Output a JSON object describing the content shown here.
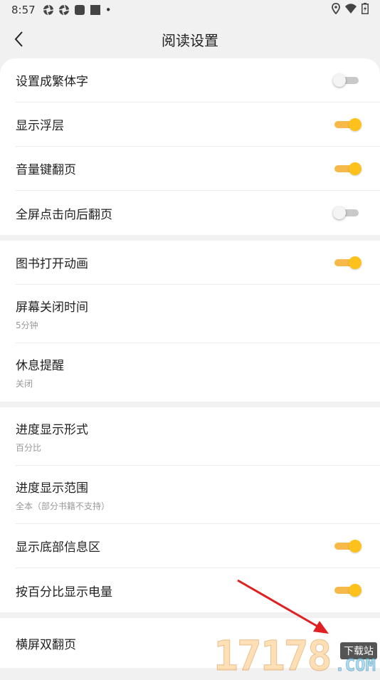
{
  "status": {
    "time": "8:57",
    "dot": "•"
  },
  "header": {
    "title": "阅读设置"
  },
  "section1": [
    {
      "label": "设置成繁体字",
      "toggle": "off"
    },
    {
      "label": "显示浮层",
      "toggle": "on"
    },
    {
      "label": "音量键翻页",
      "toggle": "on"
    },
    {
      "label": "全屏点击向后翻页",
      "toggle": "off"
    }
  ],
  "section2": [
    {
      "label": "图书打开动画",
      "toggle": "on"
    },
    {
      "label": "屏幕关闭时间",
      "sub": "5分钟"
    },
    {
      "label": "休息提醒",
      "sub": "关闭"
    }
  ],
  "section3": [
    {
      "label": "进度显示形式",
      "sub": "百分比"
    },
    {
      "label": "进度显示范围",
      "sub": "全本（部分书籍不支持）"
    },
    {
      "label": "显示底部信息区",
      "toggle": "on"
    },
    {
      "label": "按百分比显示电量",
      "toggle": "on"
    }
  ],
  "section4": [
    {
      "label": "横屏双翻页"
    }
  ],
  "watermark": {
    "digits": "17178",
    "site": "下载站",
    "domain": ".COM"
  },
  "colors": {
    "accent": "#fcc21b",
    "track_on": "#f7b94a",
    "arrow": "#e02020"
  }
}
